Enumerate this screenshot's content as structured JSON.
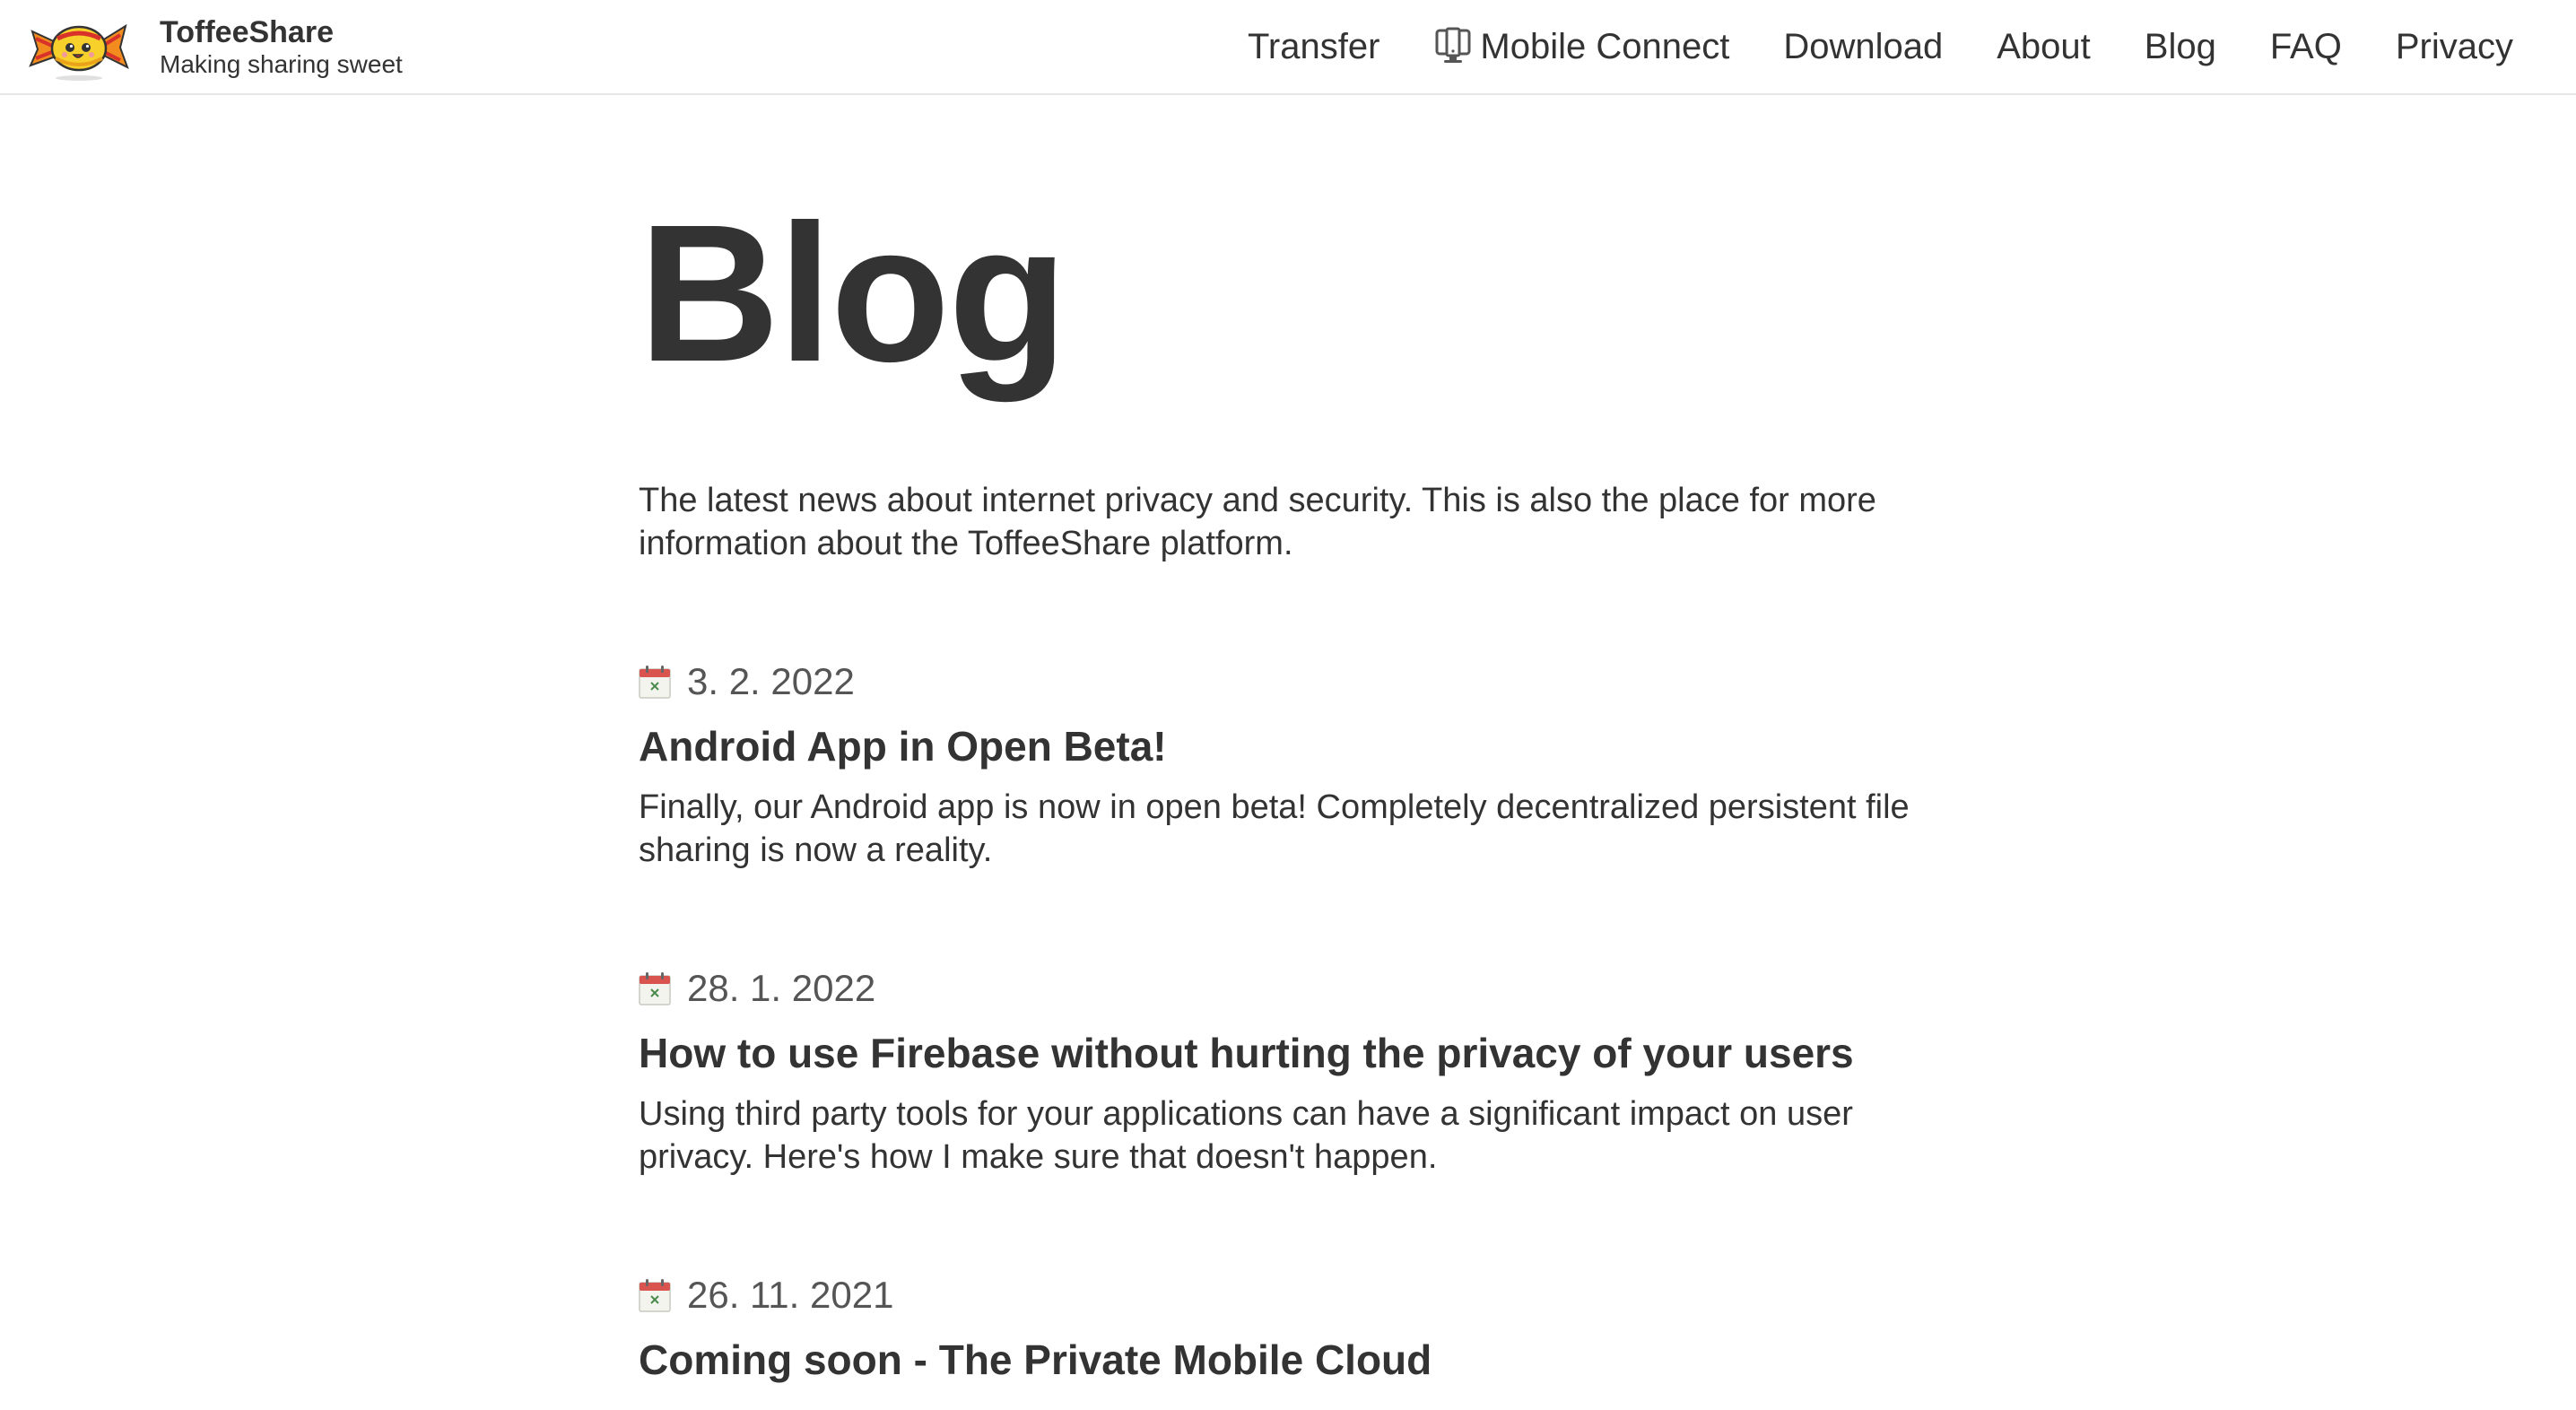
{
  "header": {
    "brand_name": "ToffeeShare",
    "brand_tagline": "Making sharing sweet",
    "logo_icon": "candy-mascot-icon"
  },
  "nav": {
    "items": [
      {
        "label": "Transfer"
      },
      {
        "label": "Mobile Connect",
        "icon": "phone-monitor-icon"
      },
      {
        "label": "Download"
      },
      {
        "label": "About"
      },
      {
        "label": "Blog"
      },
      {
        "label": "FAQ"
      },
      {
        "label": "Privacy"
      }
    ]
  },
  "main": {
    "title": "Blog",
    "intro": "The latest news about internet privacy and security. This is also the place for more information about the ToffeeShare platform.",
    "posts": [
      {
        "date": "3. 2. 2022",
        "title": "Android App in Open Beta!",
        "excerpt": "Finally, our Android app is now in open beta! Completely decentralized persistent file sharing is now a reality."
      },
      {
        "date": "28. 1. 2022",
        "title": "How to use Firebase without hurting the privacy of your users",
        "excerpt": "Using third party tools for your applications can have a significant impact on user privacy. Here's how I make sure that doesn't happen."
      },
      {
        "date": "26. 11. 2021",
        "title": "Coming soon - The Private Mobile Cloud",
        "excerpt": ""
      }
    ]
  },
  "colors": {
    "text": "#333333",
    "date_text": "#555555",
    "divider": "#e6e6e6",
    "calendar_red": "#d9534f",
    "logo_orange": "#f28c1e",
    "logo_yellow": "#f7d02c"
  }
}
